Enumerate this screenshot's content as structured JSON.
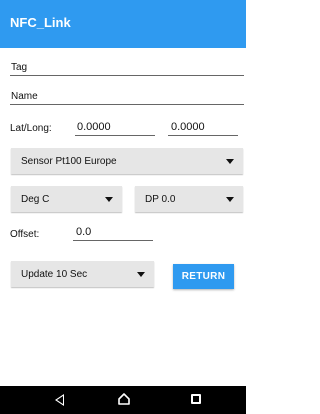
{
  "app": {
    "title": "NFC_Link"
  },
  "form": {
    "tag_label": "Tag",
    "name_label": "Name",
    "latlong_label": "Lat/Long:",
    "lat_value": "0.0000",
    "long_value": "0.0000",
    "sensor_selected": "Sensor Pt100 Europe",
    "units_selected": "Deg C",
    "dp_selected": "DP 0.0",
    "offset_label": "Offset:",
    "offset_value": "0.0",
    "update_selected": "Update 10 Sec",
    "return_label": "RETURN"
  },
  "colors": {
    "accent": "#2f9af0",
    "select_bg": "#e6e6e6",
    "navbar": "#000000"
  },
  "icons": {
    "nav": [
      "back-icon",
      "home-icon",
      "recents-icon"
    ]
  }
}
